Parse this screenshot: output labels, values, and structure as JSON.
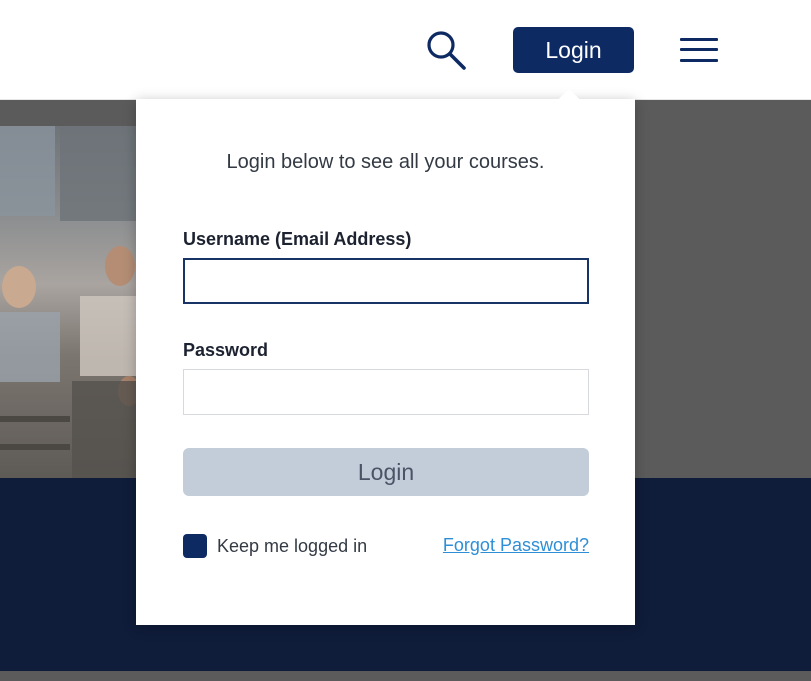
{
  "header": {
    "search_icon": "search-icon",
    "login_label": "Login",
    "menu_icon": "hamburger-menu-icon"
  },
  "login_form": {
    "intro_text": "Login below to see all your courses.",
    "username_label": "Username (Email Address)",
    "username_value": "",
    "password_label": "Password",
    "password_value": "",
    "submit_label": "Login",
    "keep_logged_in_label": "Keep me logged in",
    "forgot_password_label": "Forgot Password?"
  },
  "colors": {
    "brand_navy": "#0d2a63",
    "footer_navy": "#0f1c3a",
    "link_blue": "#2e8fd6",
    "disabled_button": "#c3ccd9"
  }
}
